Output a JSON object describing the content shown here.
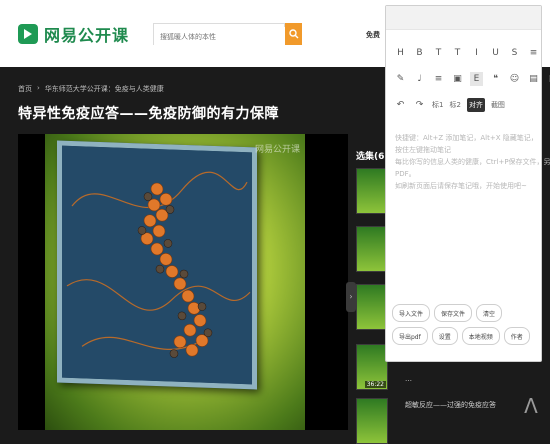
{
  "header": {
    "logo_text": "网易公开课",
    "search_placeholder": "搜狐暖人体的本性",
    "right_link": "免费"
  },
  "breadcrumb": [
    "首页",
    "›",
    "华东师范大学公开课：免疫与人类健康"
  ],
  "page_title": "特异性免疫应答——免疫防御的有力保障",
  "player": {
    "watermark": "网易公开课"
  },
  "playlist": {
    "title": "选集(6)",
    "items": [
      {
        "duration": ""
      },
      {
        "duration": ""
      },
      {
        "duration": ""
      },
      {
        "duration": "36:22",
        "text": "…"
      },
      {
        "duration": "",
        "text": "超敏反应——过强的免疫应答"
      }
    ]
  },
  "editor": {
    "row1": [
      "H",
      "B",
      "T",
      "T",
      "I",
      "U",
      "S",
      "≡"
    ],
    "row2": [
      "✎",
      "♩",
      "≡",
      "▣",
      "E",
      "❝",
      "☺",
      "▤",
      "▦"
    ],
    "row3": [
      "↶",
      "↷",
      "标1",
      "标2",
      "对齐",
      "截图"
    ],
    "hint_lines": [
      "快捷键：Alt+Z 添加笔记，Alt+X 隐藏笔记，",
      "按住左键拖动笔记",
      "每比你写的信息人类的健康，Ctrl+P保存文件，另存为",
      "PDF。",
      "如刷新页面后请保存笔记哦，开始使用吧~"
    ],
    "buttons": [
      "导入文件",
      "保存文件",
      "清空",
      "导出pdf",
      "设置",
      "本地视频",
      "作者"
    ]
  },
  "scroll_top": "Λ"
}
